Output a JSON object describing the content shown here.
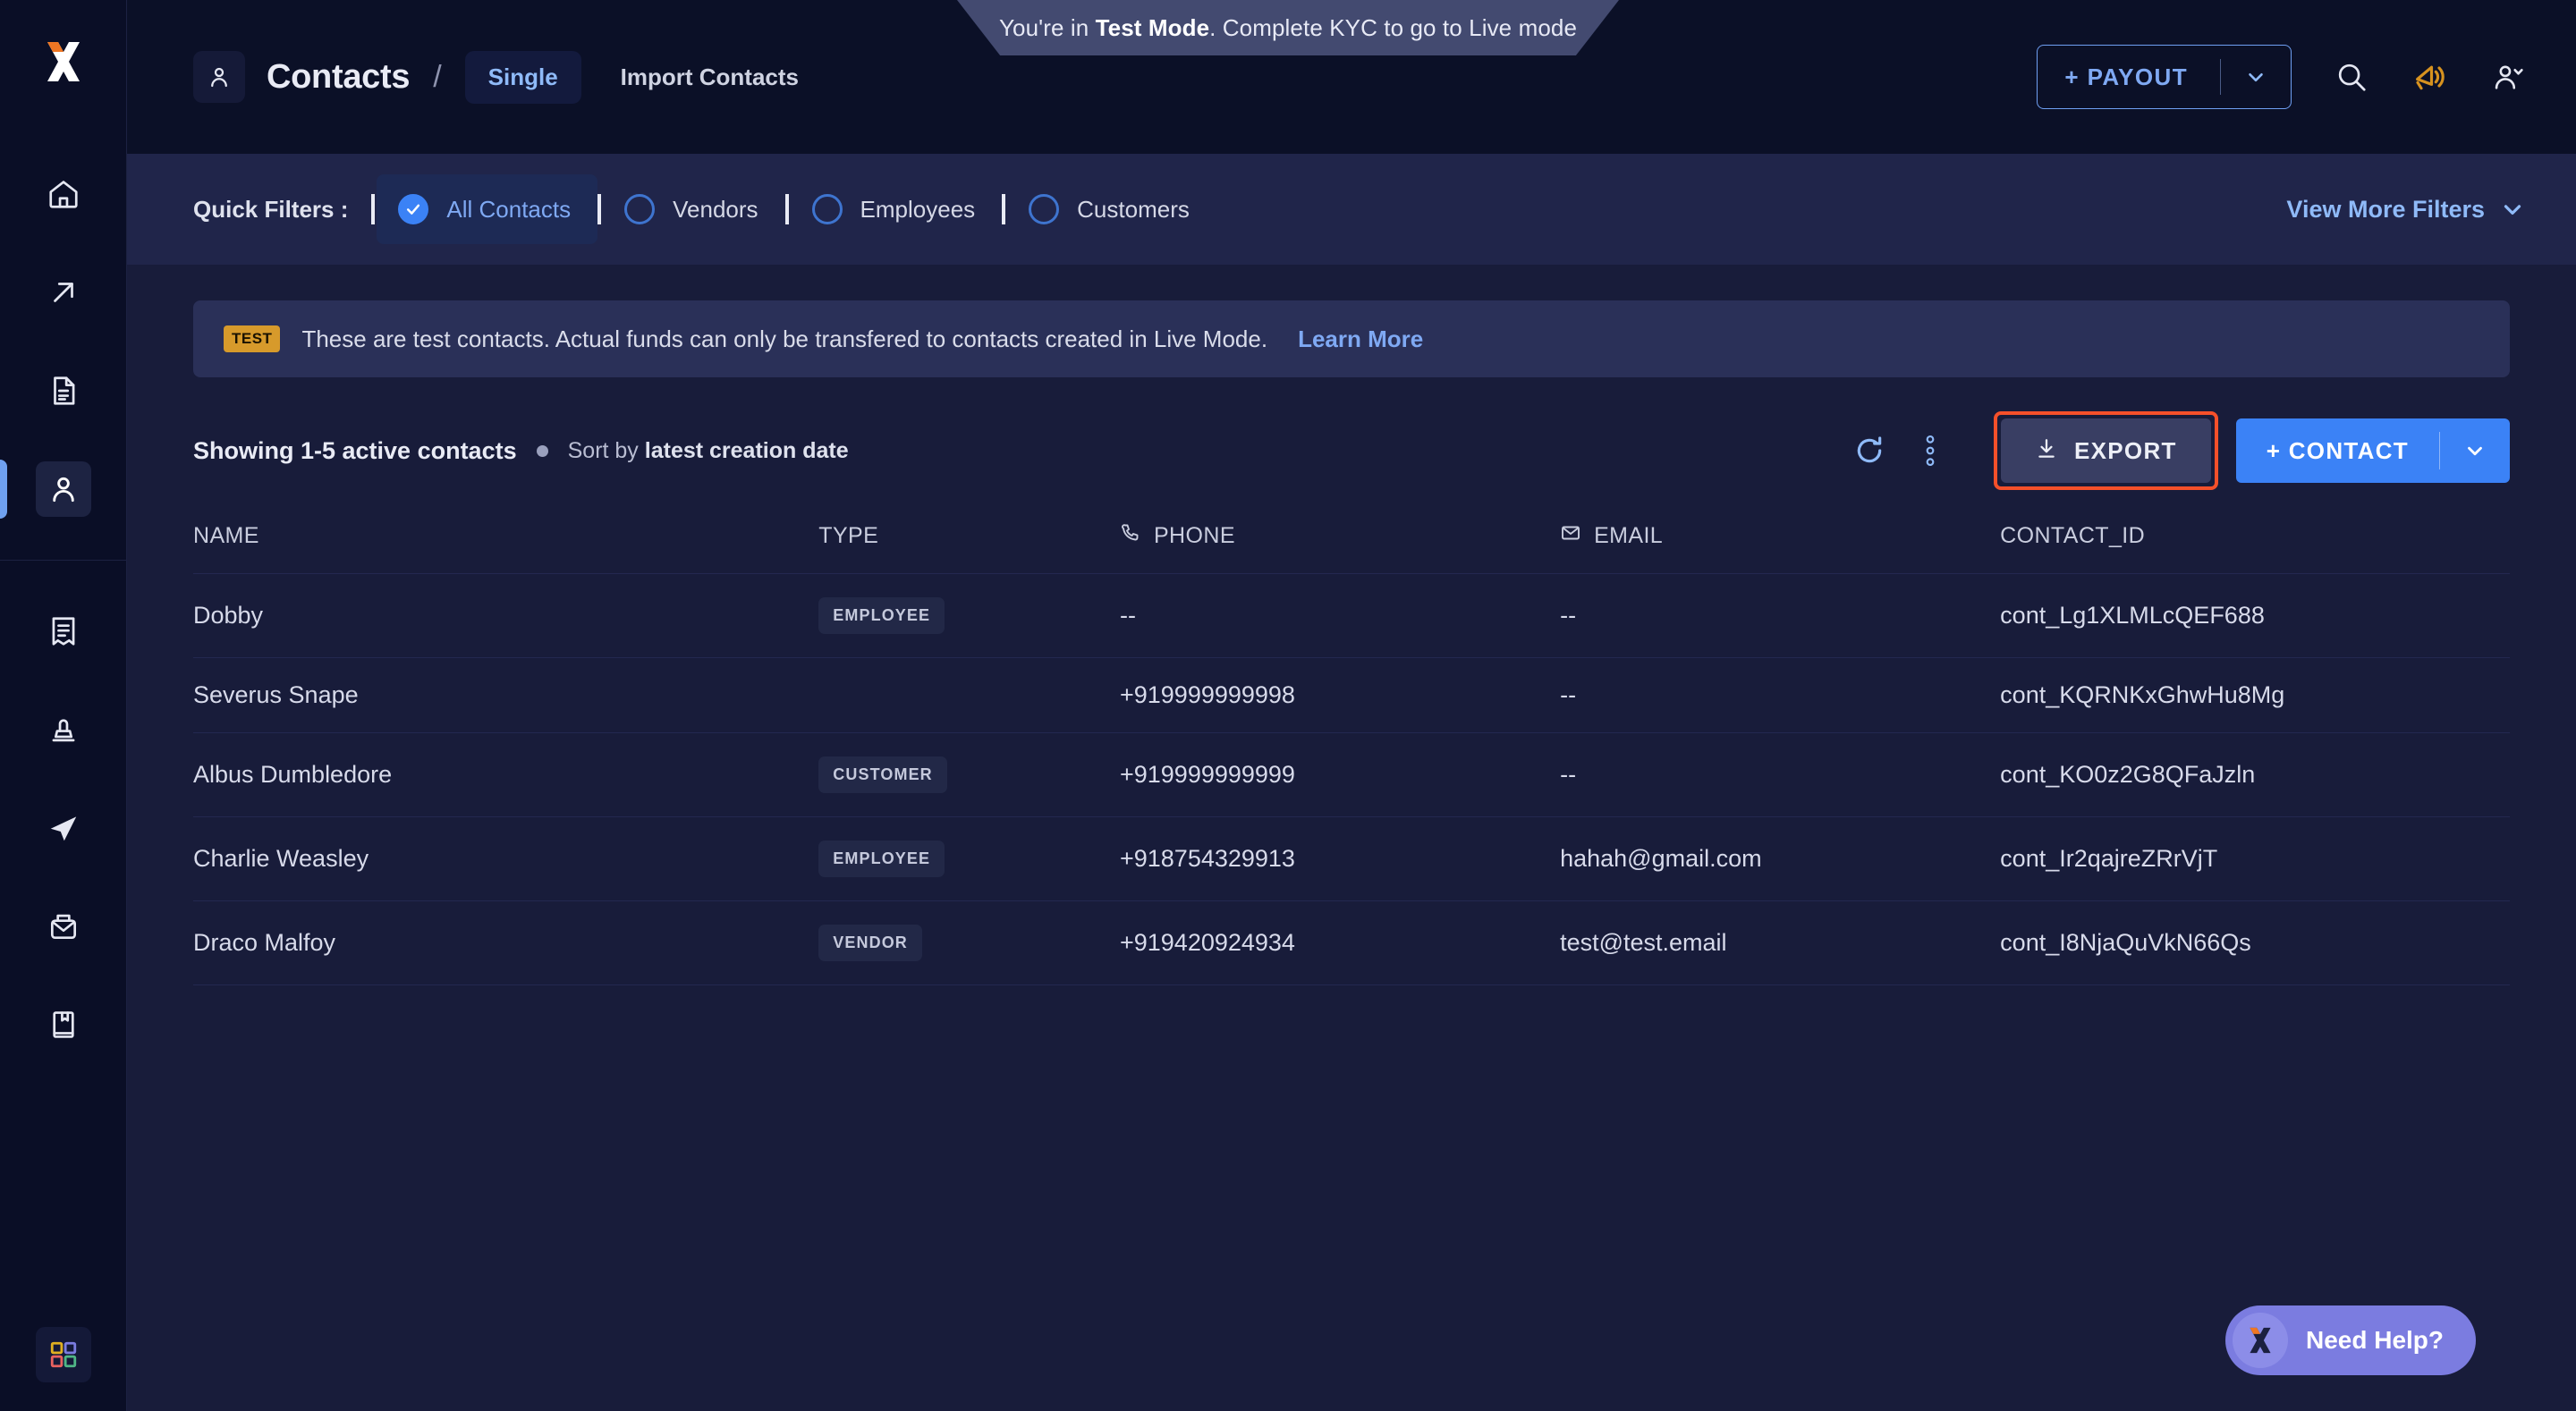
{
  "banner": {
    "prefix": "You're in ",
    "strong": "Test Mode",
    "suffix": ". Complete KYC to go to Live mode"
  },
  "header": {
    "breadcrumb_icon": "person-icon",
    "title": "Contacts",
    "separator": "/",
    "tab_active": "Single",
    "tab_secondary": "Import Contacts",
    "payout_label": "+  PAYOUT",
    "icons": [
      "search-icon",
      "announcement-icon",
      "user-add-icon"
    ]
  },
  "filters": {
    "label": "Quick Filters :",
    "chips": [
      {
        "label": "All Contacts",
        "selected": true
      },
      {
        "label": "Vendors",
        "selected": false
      },
      {
        "label": "Employees",
        "selected": false
      },
      {
        "label": "Customers",
        "selected": false
      }
    ],
    "view_more": "View More Filters"
  },
  "notice": {
    "badge": "TEST",
    "text": "These are test contacts. Actual funds can only be transfered to contacts created in Live Mode.",
    "link": "Learn More"
  },
  "toolbar": {
    "showing": "Showing 1-5 active contacts",
    "sort_prefix": "Sort by ",
    "sort_value": "latest creation date",
    "refresh_icon": "refresh-icon",
    "more_icon": "more-vertical-icon",
    "export_label": "EXPORT",
    "contact_label": "+  CONTACT",
    "export_highlight_color": "#f5502a"
  },
  "table": {
    "columns": [
      "NAME",
      "TYPE",
      "PHONE",
      "EMAIL",
      "CONTACT_ID"
    ],
    "rows": [
      {
        "name": "Dobby",
        "type": "EMPLOYEE",
        "phone": "--",
        "email": "--",
        "contact_id": "cont_Lg1XLMLcQEF688"
      },
      {
        "name": "Severus Snape",
        "type": "",
        "phone": "+919999999998",
        "email": "--",
        "contact_id": "cont_KQRNKxGhwHu8Mg"
      },
      {
        "name": "Albus Dumbledore",
        "type": "CUSTOMER",
        "phone": "+919999999999",
        "email": "--",
        "contact_id": "cont_KO0z2G8QFaJzln"
      },
      {
        "name": "Charlie Weasley",
        "type": "EMPLOYEE",
        "phone": "+918754329913",
        "email": "hahah@gmail.com",
        "contact_id": "cont_Ir2qajreZRrVjT"
      },
      {
        "name": "Draco Malfoy",
        "type": "VENDOR",
        "phone": "+919420924934",
        "email": "test@test.email",
        "contact_id": "cont_I8NjaQuVkN66Qs"
      }
    ]
  },
  "sidebar": {
    "logo": "x-logo",
    "items": [
      {
        "icon": "home-icon",
        "active": false
      },
      {
        "icon": "arrow-up-right-icon",
        "active": false
      },
      {
        "icon": "document-icon",
        "active": false
      },
      {
        "icon": "person-icon",
        "active": true
      },
      {
        "icon": "receipt-icon",
        "active": false
      },
      {
        "icon": "stamp-icon",
        "active": false
      },
      {
        "icon": "send-icon",
        "active": false
      },
      {
        "icon": "inbox-icon",
        "active": false
      },
      {
        "icon": "book-icon",
        "active": false
      }
    ],
    "bottom_icon": "apps-grid-icon"
  },
  "help": {
    "label": "Need Help?",
    "icon": "x-logo"
  },
  "colors": {
    "accent_blue": "#3b82f6",
    "light_blue": "#7fa9f3",
    "bg_dark": "#0a0e26",
    "bg_main": "#181c3a",
    "bg_filters": "#20254a",
    "notice_bg": "#2a3058",
    "test_badge": "#d79a2b",
    "help_purple": "#7b7ce0",
    "highlight_red": "#f5502a"
  }
}
